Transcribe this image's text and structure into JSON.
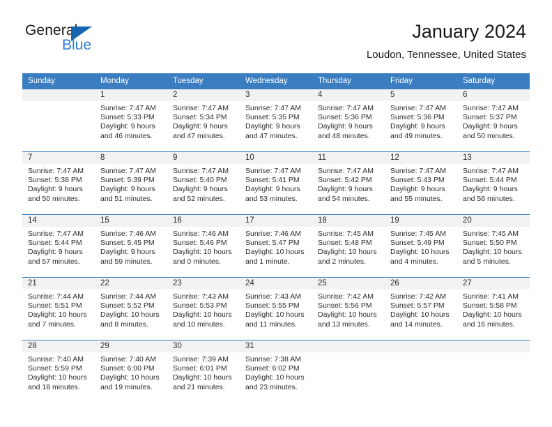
{
  "brand": {
    "word_one": "General",
    "word_two": "Blue",
    "flag_icon": "blue-triangle-flag-icon",
    "accent_dark": "#1565b0",
    "accent_blue": "#2f7fd0"
  },
  "header": {
    "title": "January 2024",
    "subtitle": "Loudon, Tennessee, United States"
  },
  "theme": {
    "header_row_bg": "#3a7dc0",
    "daynum_bg": "#f2f2f2",
    "text": "#2b2b2b"
  },
  "calendar": {
    "weekday_headers": [
      "Sunday",
      "Monday",
      "Tuesday",
      "Wednesday",
      "Thursday",
      "Friday",
      "Saturday"
    ],
    "weeks": [
      [
        {
          "day": "",
          "lines": []
        },
        {
          "day": "1",
          "lines": [
            "Sunrise: 7:47 AM",
            "Sunset: 5:33 PM",
            "Daylight: 9 hours",
            "and 46 minutes."
          ]
        },
        {
          "day": "2",
          "lines": [
            "Sunrise: 7:47 AM",
            "Sunset: 5:34 PM",
            "Daylight: 9 hours",
            "and 47 minutes."
          ]
        },
        {
          "day": "3",
          "lines": [
            "Sunrise: 7:47 AM",
            "Sunset: 5:35 PM",
            "Daylight: 9 hours",
            "and 47 minutes."
          ]
        },
        {
          "day": "4",
          "lines": [
            "Sunrise: 7:47 AM",
            "Sunset: 5:36 PM",
            "Daylight: 9 hours",
            "and 48 minutes."
          ]
        },
        {
          "day": "5",
          "lines": [
            "Sunrise: 7:47 AM",
            "Sunset: 5:36 PM",
            "Daylight: 9 hours",
            "and 49 minutes."
          ]
        },
        {
          "day": "6",
          "lines": [
            "Sunrise: 7:47 AM",
            "Sunset: 5:37 PM",
            "Daylight: 9 hours",
            "and 50 minutes."
          ]
        }
      ],
      [
        {
          "day": "7",
          "lines": [
            "Sunrise: 7:47 AM",
            "Sunset: 5:38 PM",
            "Daylight: 9 hours",
            "and 50 minutes."
          ]
        },
        {
          "day": "8",
          "lines": [
            "Sunrise: 7:47 AM",
            "Sunset: 5:39 PM",
            "Daylight: 9 hours",
            "and 51 minutes."
          ]
        },
        {
          "day": "9",
          "lines": [
            "Sunrise: 7:47 AM",
            "Sunset: 5:40 PM",
            "Daylight: 9 hours",
            "and 52 minutes."
          ]
        },
        {
          "day": "10",
          "lines": [
            "Sunrise: 7:47 AM",
            "Sunset: 5:41 PM",
            "Daylight: 9 hours",
            "and 53 minutes."
          ]
        },
        {
          "day": "11",
          "lines": [
            "Sunrise: 7:47 AM",
            "Sunset: 5:42 PM",
            "Daylight: 9 hours",
            "and 54 minutes."
          ]
        },
        {
          "day": "12",
          "lines": [
            "Sunrise: 7:47 AM",
            "Sunset: 5:43 PM",
            "Daylight: 9 hours",
            "and 55 minutes."
          ]
        },
        {
          "day": "13",
          "lines": [
            "Sunrise: 7:47 AM",
            "Sunset: 5:44 PM",
            "Daylight: 9 hours",
            "and 56 minutes."
          ]
        }
      ],
      [
        {
          "day": "14",
          "lines": [
            "Sunrise: 7:47 AM",
            "Sunset: 5:44 PM",
            "Daylight: 9 hours",
            "and 57 minutes."
          ]
        },
        {
          "day": "15",
          "lines": [
            "Sunrise: 7:46 AM",
            "Sunset: 5:45 PM",
            "Daylight: 9 hours",
            "and 59 minutes."
          ]
        },
        {
          "day": "16",
          "lines": [
            "Sunrise: 7:46 AM",
            "Sunset: 5:46 PM",
            "Daylight: 10 hours",
            "and 0 minutes."
          ]
        },
        {
          "day": "17",
          "lines": [
            "Sunrise: 7:46 AM",
            "Sunset: 5:47 PM",
            "Daylight: 10 hours",
            "and 1 minute."
          ]
        },
        {
          "day": "18",
          "lines": [
            "Sunrise: 7:45 AM",
            "Sunset: 5:48 PM",
            "Daylight: 10 hours",
            "and 2 minutes."
          ]
        },
        {
          "day": "19",
          "lines": [
            "Sunrise: 7:45 AM",
            "Sunset: 5:49 PM",
            "Daylight: 10 hours",
            "and 4 minutes."
          ]
        },
        {
          "day": "20",
          "lines": [
            "Sunrise: 7:45 AM",
            "Sunset: 5:50 PM",
            "Daylight: 10 hours",
            "and 5 minutes."
          ]
        }
      ],
      [
        {
          "day": "21",
          "lines": [
            "Sunrise: 7:44 AM",
            "Sunset: 5:51 PM",
            "Daylight: 10 hours",
            "and 7 minutes."
          ]
        },
        {
          "day": "22",
          "lines": [
            "Sunrise: 7:44 AM",
            "Sunset: 5:52 PM",
            "Daylight: 10 hours",
            "and 8 minutes."
          ]
        },
        {
          "day": "23",
          "lines": [
            "Sunrise: 7:43 AM",
            "Sunset: 5:53 PM",
            "Daylight: 10 hours",
            "and 10 minutes."
          ]
        },
        {
          "day": "24",
          "lines": [
            "Sunrise: 7:43 AM",
            "Sunset: 5:55 PM",
            "Daylight: 10 hours",
            "and 11 minutes."
          ]
        },
        {
          "day": "25",
          "lines": [
            "Sunrise: 7:42 AM",
            "Sunset: 5:56 PM",
            "Daylight: 10 hours",
            "and 13 minutes."
          ]
        },
        {
          "day": "26",
          "lines": [
            "Sunrise: 7:42 AM",
            "Sunset: 5:57 PM",
            "Daylight: 10 hours",
            "and 14 minutes."
          ]
        },
        {
          "day": "27",
          "lines": [
            "Sunrise: 7:41 AM",
            "Sunset: 5:58 PM",
            "Daylight: 10 hours",
            "and 16 minutes."
          ]
        }
      ],
      [
        {
          "day": "28",
          "lines": [
            "Sunrise: 7:40 AM",
            "Sunset: 5:59 PM",
            "Daylight: 10 hours",
            "and 18 minutes."
          ]
        },
        {
          "day": "29",
          "lines": [
            "Sunrise: 7:40 AM",
            "Sunset: 6:00 PM",
            "Daylight: 10 hours",
            "and 19 minutes."
          ]
        },
        {
          "day": "30",
          "lines": [
            "Sunrise: 7:39 AM",
            "Sunset: 6:01 PM",
            "Daylight: 10 hours",
            "and 21 minutes."
          ]
        },
        {
          "day": "31",
          "lines": [
            "Sunrise: 7:38 AM",
            "Sunset: 6:02 PM",
            "Daylight: 10 hours",
            "and 23 minutes."
          ]
        },
        {
          "day": "",
          "lines": []
        },
        {
          "day": "",
          "lines": []
        },
        {
          "day": "",
          "lines": []
        }
      ]
    ]
  }
}
